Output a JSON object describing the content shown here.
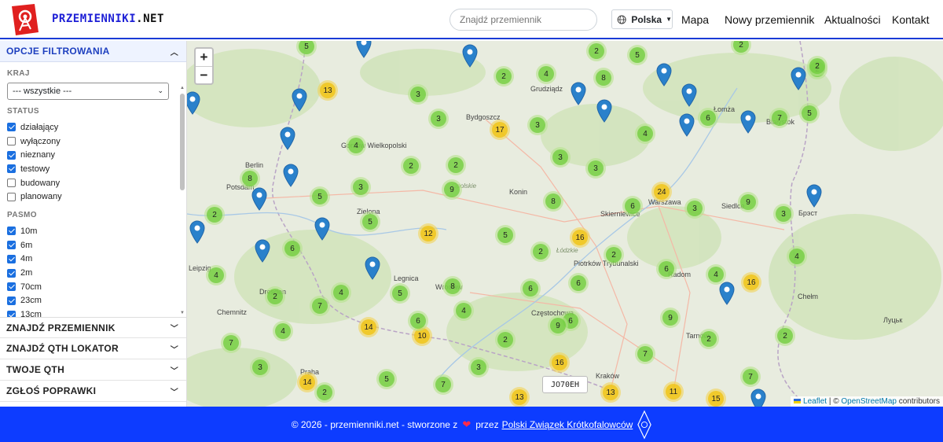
{
  "header": {
    "brand_part1": "PRZEMIENNIKI",
    "brand_part2": ".NET",
    "search_placeholder": "Znajdź przemiennik",
    "country": "Polska",
    "nav": [
      "Mapa",
      "Nowy przemiennik",
      "Aktualności",
      "Kontakt"
    ]
  },
  "sidebar": {
    "filter_title": "OPCJE FILTROWANIA",
    "kraj_label": "KRAJ",
    "kraj_value": "--- wszystkie ---",
    "status_label": "STATUS",
    "status": [
      {
        "label": "działający",
        "checked": true
      },
      {
        "label": "wyłączony",
        "checked": false
      },
      {
        "label": "nieznany",
        "checked": true
      },
      {
        "label": "testowy",
        "checked": true
      },
      {
        "label": "budowany",
        "checked": false
      },
      {
        "label": "planowany",
        "checked": false
      }
    ],
    "pasmo_label": "PASMO",
    "pasmo": [
      {
        "label": "10m",
        "checked": true
      },
      {
        "label": "6m",
        "checked": true
      },
      {
        "label": "4m",
        "checked": true
      },
      {
        "label": "2m",
        "checked": true
      },
      {
        "label": "70cm",
        "checked": true
      },
      {
        "label": "23cm",
        "checked": true
      },
      {
        "label": "13cm",
        "checked": true
      }
    ],
    "sections": [
      "ZNAJDŹ PRZEMIENNIK",
      "ZNAJDŹ QTH LOKATOR",
      "TWOJE QTH",
      "ZGŁOŚ POPRAWKI"
    ]
  },
  "map": {
    "zoom_in": "+",
    "zoom_out": "−",
    "qth_popup": "JO70EH",
    "attribution_leaflet": "Leaflet",
    "attribution_osm": "OpenStreetMap",
    "attribution_suffix": "contributors",
    "labels": [
      "Bydgoszcz",
      "Grudziądz",
      "Berlin",
      "Potsdam",
      "Gorzów Wielkopolski",
      "Zielona",
      "Konin",
      "Warszawa",
      "Skierniewice",
      "Siedlce",
      "Łomża",
      "Białystok",
      "Piotrków Trybunalski",
      "Częstochowa",
      "Kraków",
      "Wrocław",
      "Legnica",
      "Dresden",
      "Chemnitz",
      "Leipzig",
      "Praha",
      "Chełm",
      "Брэст",
      "Луцьк",
      "Łódzkie",
      "Opolskie",
      "Tarnów",
      "Radom"
    ],
    "clusters": [
      {
        "n": "5",
        "c": "g"
      },
      {
        "n": "13",
        "c": "y"
      },
      {
        "n": "3",
        "c": "g"
      },
      {
        "n": "2",
        "c": "g"
      },
      {
        "n": "4",
        "c": "g"
      },
      {
        "n": "2",
        "c": "g"
      },
      {
        "n": "5",
        "c": "g"
      },
      {
        "n": "8",
        "c": "g"
      },
      {
        "n": "2",
        "c": "g"
      },
      {
        "n": "2",
        "c": "g"
      },
      {
        "n": "3",
        "c": "g"
      },
      {
        "n": "17",
        "c": "y"
      },
      {
        "n": "3",
        "c": "g"
      },
      {
        "n": "6",
        "c": "g"
      },
      {
        "n": "7",
        "c": "g"
      },
      {
        "n": "4",
        "c": "g"
      },
      {
        "n": "4",
        "c": "g"
      },
      {
        "n": "2",
        "c": "g"
      },
      {
        "n": "2",
        "c": "g"
      },
      {
        "n": "3",
        "c": "g"
      },
      {
        "n": "3",
        "c": "g"
      },
      {
        "n": "8",
        "c": "g"
      },
      {
        "n": "3",
        "c": "g"
      },
      {
        "n": "9",
        "c": "g"
      },
      {
        "n": "24",
        "c": "y"
      },
      {
        "n": "9",
        "c": "g"
      },
      {
        "n": "2",
        "c": "g"
      },
      {
        "n": "5",
        "c": "g"
      },
      {
        "n": "8",
        "c": "g"
      },
      {
        "n": "6",
        "c": "g"
      },
      {
        "n": "3",
        "c": "g"
      },
      {
        "n": "3",
        "c": "g"
      },
      {
        "n": "5",
        "c": "g"
      },
      {
        "n": "12",
        "c": "y"
      },
      {
        "n": "5",
        "c": "g"
      },
      {
        "n": "16",
        "c": "y"
      },
      {
        "n": "6",
        "c": "g"
      },
      {
        "n": "2",
        "c": "g"
      },
      {
        "n": "2",
        "c": "g"
      },
      {
        "n": "4",
        "c": "g"
      },
      {
        "n": "4",
        "c": "g"
      },
      {
        "n": "6",
        "c": "g"
      },
      {
        "n": "4",
        "c": "g"
      },
      {
        "n": "16",
        "c": "y"
      },
      {
        "n": "2",
        "c": "g"
      },
      {
        "n": "7",
        "c": "g"
      },
      {
        "n": "4",
        "c": "g"
      },
      {
        "n": "5",
        "c": "g"
      },
      {
        "n": "8",
        "c": "g"
      },
      {
        "n": "6",
        "c": "g"
      },
      {
        "n": "6",
        "c": "g"
      },
      {
        "n": "4",
        "c": "g"
      },
      {
        "n": "6",
        "c": "g"
      },
      {
        "n": "9",
        "c": "g"
      },
      {
        "n": "9",
        "c": "g"
      },
      {
        "n": "7",
        "c": "g"
      },
      {
        "n": "4",
        "c": "g"
      },
      {
        "n": "14",
        "c": "y"
      },
      {
        "n": "10",
        "c": "y"
      },
      {
        "n": "6",
        "c": "g"
      },
      {
        "n": "2",
        "c": "g"
      },
      {
        "n": "2",
        "c": "g"
      },
      {
        "n": "2",
        "c": "g"
      },
      {
        "n": "7",
        "c": "g"
      },
      {
        "n": "3",
        "c": "g"
      },
      {
        "n": "16",
        "c": "y"
      },
      {
        "n": "7",
        "c": "g"
      },
      {
        "n": "3",
        "c": "g"
      },
      {
        "n": "14",
        "c": "y"
      },
      {
        "n": "2",
        "c": "g"
      },
      {
        "n": "5",
        "c": "g"
      },
      {
        "n": "7",
        "c": "g"
      },
      {
        "n": "13",
        "c": "y"
      },
      {
        "n": "13",
        "c": "y"
      },
      {
        "n": "11",
        "c": "y"
      },
      {
        "n": "5",
        "c": "g"
      },
      {
        "n": "15",
        "c": "y"
      },
      {
        "n": "2",
        "c": "g"
      }
    ],
    "pin_count": 21
  },
  "footer": {
    "text": "© 2026 - przemienniki.net - stworzone z",
    "heart": "❤",
    "by": "przez",
    "link": "Polski Związek Krótkofalowców"
  },
  "colors": {
    "brand_blue": "#0d3cff",
    "cluster_green": "#6ecc39",
    "cluster_yellow": "#f0c20c",
    "pin_blue": "#2a81cb"
  }
}
